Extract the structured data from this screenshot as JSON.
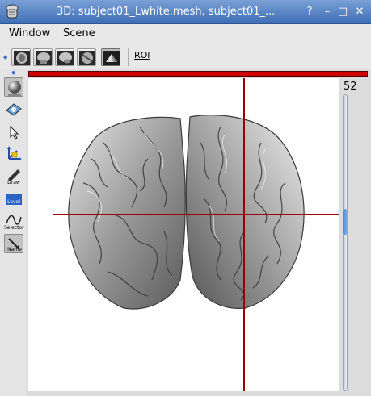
{
  "window": {
    "title": "3D: subject01_Lwhite.mesh, subject01_...",
    "buttons": {
      "help": "?",
      "minimize": "–",
      "maximize": "□",
      "close": "✕"
    }
  },
  "menu": {
    "items": [
      "Window",
      "Scene"
    ]
  },
  "toolbar": {
    "views": [
      "axial-view",
      "coronal-view",
      "sagittal-view",
      "oblique-view",
      "3d-view"
    ],
    "roi_label": "ROI"
  },
  "palette": {
    "tools": [
      {
        "name": "trackball",
        "label": ""
      },
      {
        "name": "flight",
        "label": ""
      },
      {
        "name": "select",
        "label": ""
      },
      {
        "name": "transform",
        "label": ""
      },
      {
        "name": "draw",
        "label": "Draw"
      },
      {
        "name": "level",
        "label": "Level"
      },
      {
        "name": "synapse-selector",
        "label": "Selector"
      },
      {
        "name": "name",
        "label": "Name"
      }
    ]
  },
  "slider": {
    "value": "52",
    "fraction": 0.42
  },
  "colors": {
    "crosshair": "#9b0000",
    "titlebar": "#4f7ec2",
    "slider_handle": "#4a86da"
  }
}
